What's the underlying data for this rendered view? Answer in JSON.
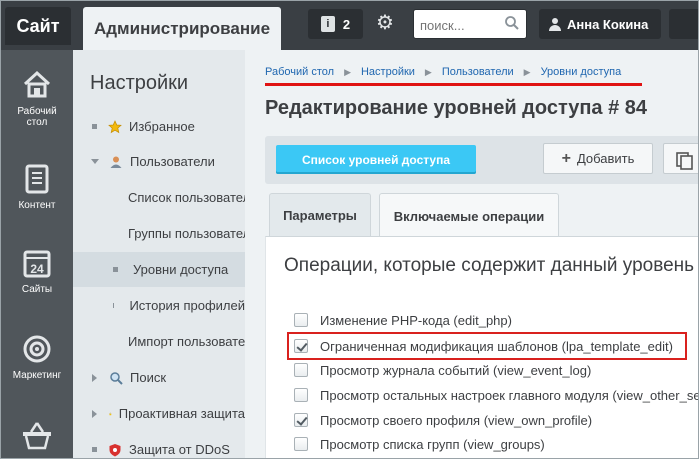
{
  "topbar": {
    "site_label": "Сайт",
    "admin_tab_label": "Администрирование",
    "notifications_count": "2",
    "search_placeholder": "поиск...",
    "user_name": "Анна Кокина"
  },
  "leftnav": {
    "items": [
      {
        "label_line1": "Рабочий",
        "label_line2": "стол",
        "icon": "home-icon"
      },
      {
        "label_line1": "Контент",
        "label_line2": "",
        "icon": "document-icon"
      },
      {
        "label_line1": "Сайты",
        "label_line2": "",
        "icon": "calendar-icon",
        "icon_text": "24"
      },
      {
        "label_line1": "Маркетинг",
        "label_line2": "",
        "icon": "target-icon"
      },
      {
        "label_line1": "",
        "label_line2": "",
        "icon": "basket-icon"
      }
    ]
  },
  "sidebar": {
    "title": "Настройки",
    "items": [
      {
        "label": "Избранное",
        "icon": "star-icon"
      },
      {
        "label": "Пользователи",
        "icon": "user-icon"
      },
      {
        "label": "Список пользователей"
      },
      {
        "label": "Группы пользователей"
      },
      {
        "label": "Уровни доступа"
      },
      {
        "label": "История профилей"
      },
      {
        "label": "Импорт пользователей"
      },
      {
        "label": "Поиск",
        "icon": "search-icon"
      },
      {
        "label": "Проактивная защита",
        "icon": "lock-icon"
      },
      {
        "label": "Защита от DDoS",
        "icon": "shield-icon"
      }
    ]
  },
  "breadcrumb": [
    "Рабочий стол",
    "Настройки",
    "Пользователи",
    "Уровни доступа"
  ],
  "page_title": "Редактирование уровней доступа # 84",
  "toolbar": {
    "list_button": "Список уровней доступа",
    "add_button": "Добавить"
  },
  "tabs": [
    "Параметры",
    "Включаемые операции"
  ],
  "panel": {
    "heading": "Операции, которые содержит данный уровень доступа",
    "operations": [
      {
        "label": "Изменение PHP-кода (edit_php)",
        "checked": false
      },
      {
        "label": "Ограниченная модификация шаблонов (lpa_template_edit)",
        "checked": true
      },
      {
        "label": "Просмотр журнала событий (view_event_log)",
        "checked": false
      },
      {
        "label": "Просмотр остальных настроек главного модуля (view_other_settings)",
        "checked": false
      },
      {
        "label": "Просмотр своего профиля (view_own_profile)",
        "checked": true
      },
      {
        "label": "Просмотр списка групп (view_groups)",
        "checked": false
      }
    ]
  },
  "colors": {
    "accent": "#3bc8f5",
    "link": "#2067b0",
    "highlight": "#d9211e",
    "topbar": "#3a3f44",
    "leftnav": "#50565b"
  }
}
